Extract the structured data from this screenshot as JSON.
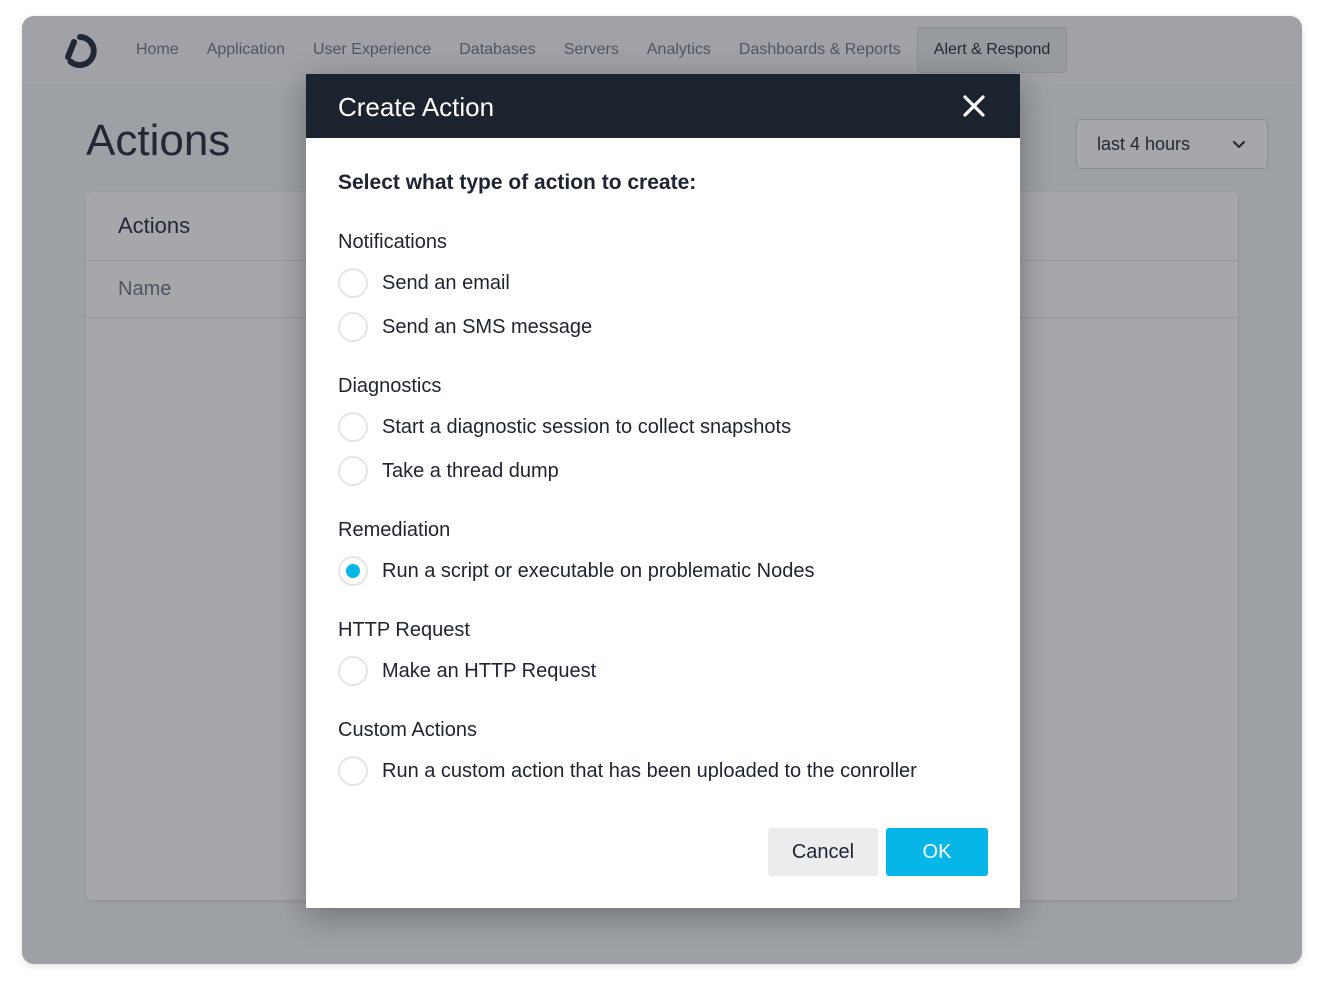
{
  "nav": {
    "items": [
      "Home",
      "Application",
      "User Experience",
      "Databases",
      "Servers",
      "Analytics",
      "Dashboards & Reports"
    ],
    "active": "Alert & Respond"
  },
  "page": {
    "title": "Actions",
    "time_range": "last 4 hours"
  },
  "card": {
    "header": "Actions",
    "column_name": "Name"
  },
  "modal": {
    "title": "Create Action",
    "prompt": "Select what type of action to create:",
    "sections": [
      {
        "label": "Notifications",
        "options": [
          {
            "label": "Send an email",
            "selected": false
          },
          {
            "label": "Send an SMS message",
            "selected": false
          }
        ]
      },
      {
        "label": "Diagnostics",
        "options": [
          {
            "label": "Start a diagnostic session to collect snapshots",
            "selected": false
          },
          {
            "label": "Take a thread dump",
            "selected": false
          }
        ]
      },
      {
        "label": "Remediation",
        "options": [
          {
            "label": "Run a script or executable on problematic Nodes",
            "selected": true
          }
        ]
      },
      {
        "label": "HTTP Request",
        "options": [
          {
            "label": "Make an HTTP Request",
            "selected": false
          }
        ]
      },
      {
        "label": "Custom Actions",
        "options": [
          {
            "label": "Run a custom action that has been uploaded to the conroller",
            "selected": false
          }
        ]
      }
    ],
    "cancel_label": "Cancel",
    "ok_label": "OK"
  },
  "colors": {
    "accent": "#06b6e8",
    "modal_header": "#1b232e"
  }
}
